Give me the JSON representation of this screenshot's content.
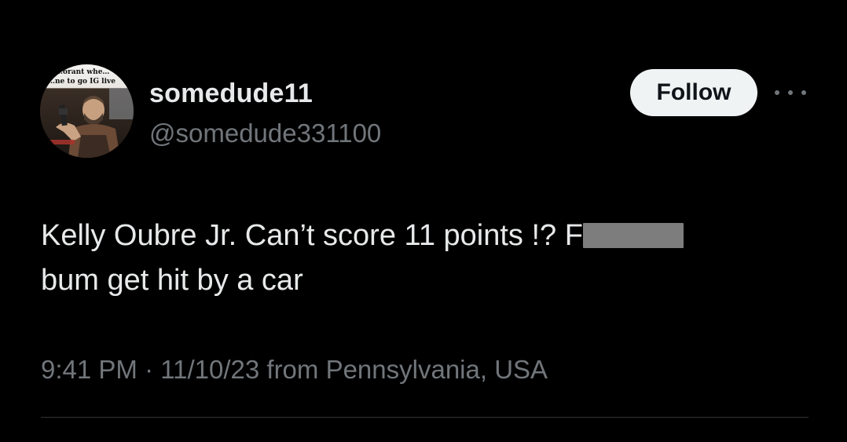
{
  "tweet": {
    "avatar_caption": [
      "…orant whe…",
      "…ne to go IG live"
    ],
    "display_name": "somedude11",
    "handle": "@somedude331100",
    "follow_label": "Follow",
    "more_icon": "ellipsis-icon",
    "text_line1_before": "Kelly Oubre Jr. Can’t score 11 points !? F",
    "text_line2": "bum get hit by a car",
    "timestamp": "9:41 PM · 11/10/23 from Pennsylvania, USA"
  },
  "colors": {
    "background": "#000000",
    "primary_text": "#e7e9ea",
    "secondary_text": "#71767b",
    "follow_button_bg": "#eff3f4",
    "follow_button_text": "#0f1419",
    "censor_block": "#7d7d7d",
    "divider": "#2f3336"
  }
}
